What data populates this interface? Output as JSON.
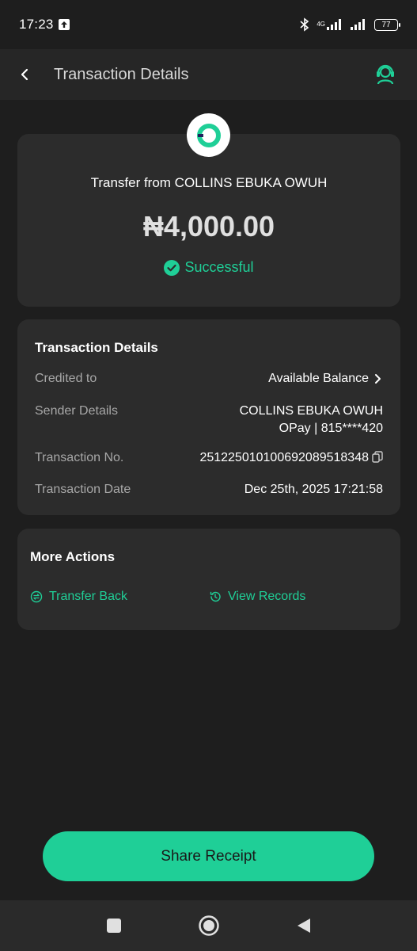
{
  "status_bar": {
    "time": "17:23",
    "network_label": "4G",
    "battery_level": "77"
  },
  "header": {
    "title": "Transaction Details",
    "back_icon": "chevron-left-icon",
    "support_icon": "headset-icon"
  },
  "summary": {
    "title": "Transfer from COLLINS EBUKA OWUH",
    "amount": "₦4,000.00",
    "status": "Successful",
    "status_color": "#1fcf97"
  },
  "details": {
    "heading": "Transaction Details",
    "credited_to_label": "Credited to",
    "credited_to_value": "Available Balance",
    "sender_label": "Sender Details",
    "sender_name": "COLLINS EBUKA OWUH",
    "sender_account": "OPay | 815****420",
    "txn_no_label": "Transaction No.",
    "txn_no_value": "251225010100692089518348",
    "txn_date_label": "Transaction Date",
    "txn_date_value": "Dec 25th, 2025 17:21:58"
  },
  "more_actions": {
    "heading": "More Actions",
    "transfer_back": "Transfer Back",
    "view_records": "View Records"
  },
  "share_button": {
    "label": "Share Receipt",
    "color": "#1fcf97"
  }
}
